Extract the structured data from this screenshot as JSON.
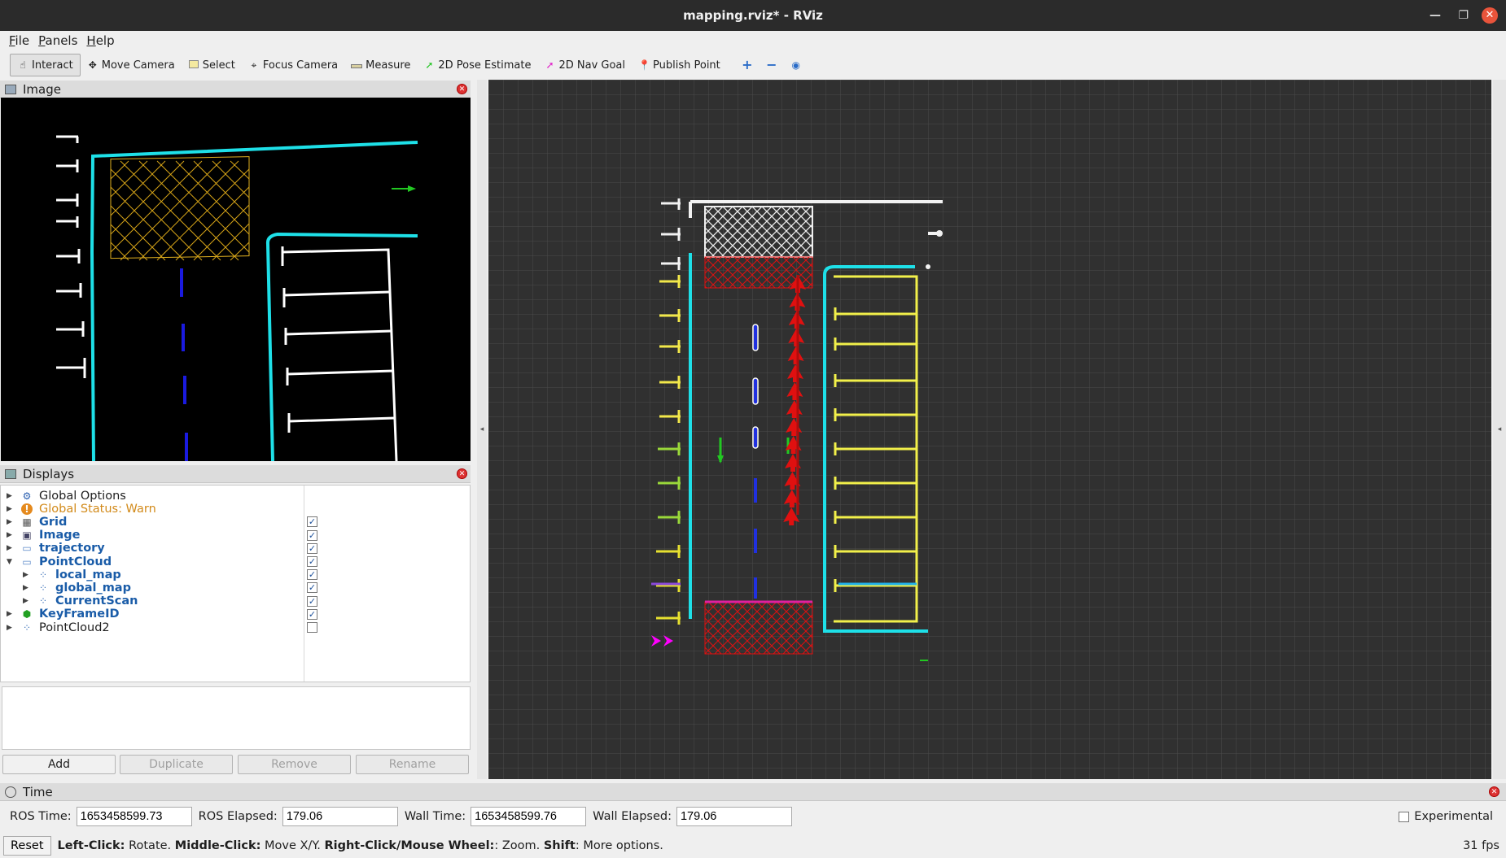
{
  "window": {
    "title": "mapping.rviz* - RViz"
  },
  "menu": [
    "File",
    "Panels",
    "Help"
  ],
  "toolbar": [
    {
      "label": "Interact",
      "icon": "hand-icon"
    },
    {
      "label": "Move Camera",
      "icon": "move-camera-icon"
    },
    {
      "label": "Select",
      "icon": "select-box-icon"
    },
    {
      "label": "Focus Camera",
      "icon": "crosshair-icon"
    },
    {
      "label": "Measure",
      "icon": "ruler-icon"
    },
    {
      "label": "2D Pose Estimate",
      "icon": "green-arrow-icon"
    },
    {
      "label": "2D Nav Goal",
      "icon": "magenta-arrow-icon"
    },
    {
      "label": "Publish Point",
      "icon": "pin-icon"
    }
  ],
  "panels": {
    "image": "Image",
    "displays": "Displays",
    "time": "Time"
  },
  "displays": [
    {
      "label": "Global Options",
      "style": "normal",
      "expanded": false,
      "indent": 0,
      "checked": null,
      "icon": "gear-icon"
    },
    {
      "label": "Global Status: Warn",
      "style": "warn",
      "expanded": false,
      "indent": 0,
      "checked": null,
      "icon": "warning-icon"
    },
    {
      "label": "Grid",
      "style": "blue",
      "expanded": false,
      "indent": 0,
      "checked": true,
      "icon": "grid-icon"
    },
    {
      "label": "Image",
      "style": "blue",
      "expanded": false,
      "indent": 0,
      "checked": true,
      "icon": "image-icon"
    },
    {
      "label": "trajectory",
      "style": "blue",
      "expanded": false,
      "indent": 0,
      "checked": true,
      "icon": "folder-icon"
    },
    {
      "label": "PointCloud",
      "style": "blue",
      "expanded": true,
      "indent": 0,
      "checked": true,
      "icon": "folder-icon"
    },
    {
      "label": "local_map",
      "style": "blue",
      "expanded": false,
      "indent": 1,
      "checked": true,
      "icon": "pointcloud-icon"
    },
    {
      "label": "global_map",
      "style": "blue",
      "expanded": false,
      "indent": 1,
      "checked": true,
      "icon": "pointcloud-icon"
    },
    {
      "label": "CurrentScan",
      "style": "blue",
      "expanded": false,
      "indent": 1,
      "checked": true,
      "icon": "pointcloud-icon"
    },
    {
      "label": "KeyFrameID",
      "style": "blue",
      "expanded": false,
      "indent": 0,
      "checked": true,
      "icon": "marker-icon"
    },
    {
      "label": "PointCloud2",
      "style": "normal",
      "expanded": false,
      "indent": 0,
      "checked": false,
      "icon": "pointcloud-icon"
    }
  ],
  "buttons": {
    "add": "Add",
    "duplicate": "Duplicate",
    "remove": "Remove",
    "rename": "Rename"
  },
  "time": {
    "ros_time_label": "ROS Time:",
    "ros_time": "1653458599.73",
    "ros_elapsed_label": "ROS Elapsed:",
    "ros_elapsed": "179.06",
    "wall_time_label": "Wall Time:",
    "wall_time": "1653458599.76",
    "wall_elapsed_label": "Wall Elapsed:",
    "wall_elapsed": "179.06",
    "experimental": "Experimental"
  },
  "status": {
    "reset": "Reset",
    "hint_parts": [
      "Left-Click:",
      " Rotate. ",
      "Middle-Click:",
      " Move X/Y. ",
      "Right-Click/Mouse Wheel:",
      ": Zoom. ",
      "Shift",
      ": More options."
    ],
    "fps": "31 fps"
  },
  "colors": {
    "cyan": "#1ee0e8",
    "yellow": "#f2f04a",
    "red": "#e01010",
    "magenta": "#ff00ff",
    "grid_bg": "#303030"
  }
}
